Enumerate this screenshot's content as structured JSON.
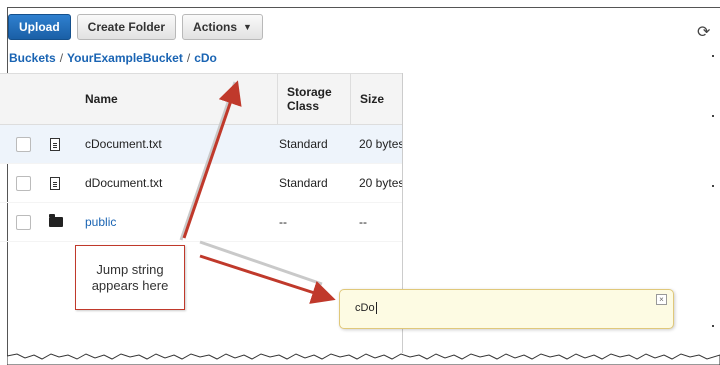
{
  "toolbar": {
    "upload_label": "Upload",
    "create_folder_label": "Create Folder",
    "actions_label": "Actions",
    "refresh_icon": "refresh-icon"
  },
  "breadcrumb": {
    "root": "Buckets",
    "bucket": "YourExampleBucket",
    "current": "cDo"
  },
  "table": {
    "headers": {
      "name": "Name",
      "storage_class_line1": "Storage",
      "storage_class_line2": "Class",
      "size": "Size"
    },
    "rows": [
      {
        "name": "cDocument.txt",
        "type": "file",
        "storage_class": "Standard",
        "size": "20 bytes",
        "selected": true
      },
      {
        "name": "dDocument.txt",
        "type": "file",
        "storage_class": "Standard",
        "size": "20 bytes",
        "selected": false
      },
      {
        "name": "public",
        "type": "folder",
        "storage_class": "--",
        "size": "--",
        "selected": false
      }
    ]
  },
  "callout": {
    "line1": "Jump string",
    "line2": "appears here"
  },
  "jump_box": {
    "value": "cDo",
    "close_symbol": "×"
  },
  "colors": {
    "primary_button": "#1a64b3",
    "link": "#1a64b3",
    "annotation_arrow": "#c0392b",
    "jump_box_bg": "#fdfbe3"
  }
}
